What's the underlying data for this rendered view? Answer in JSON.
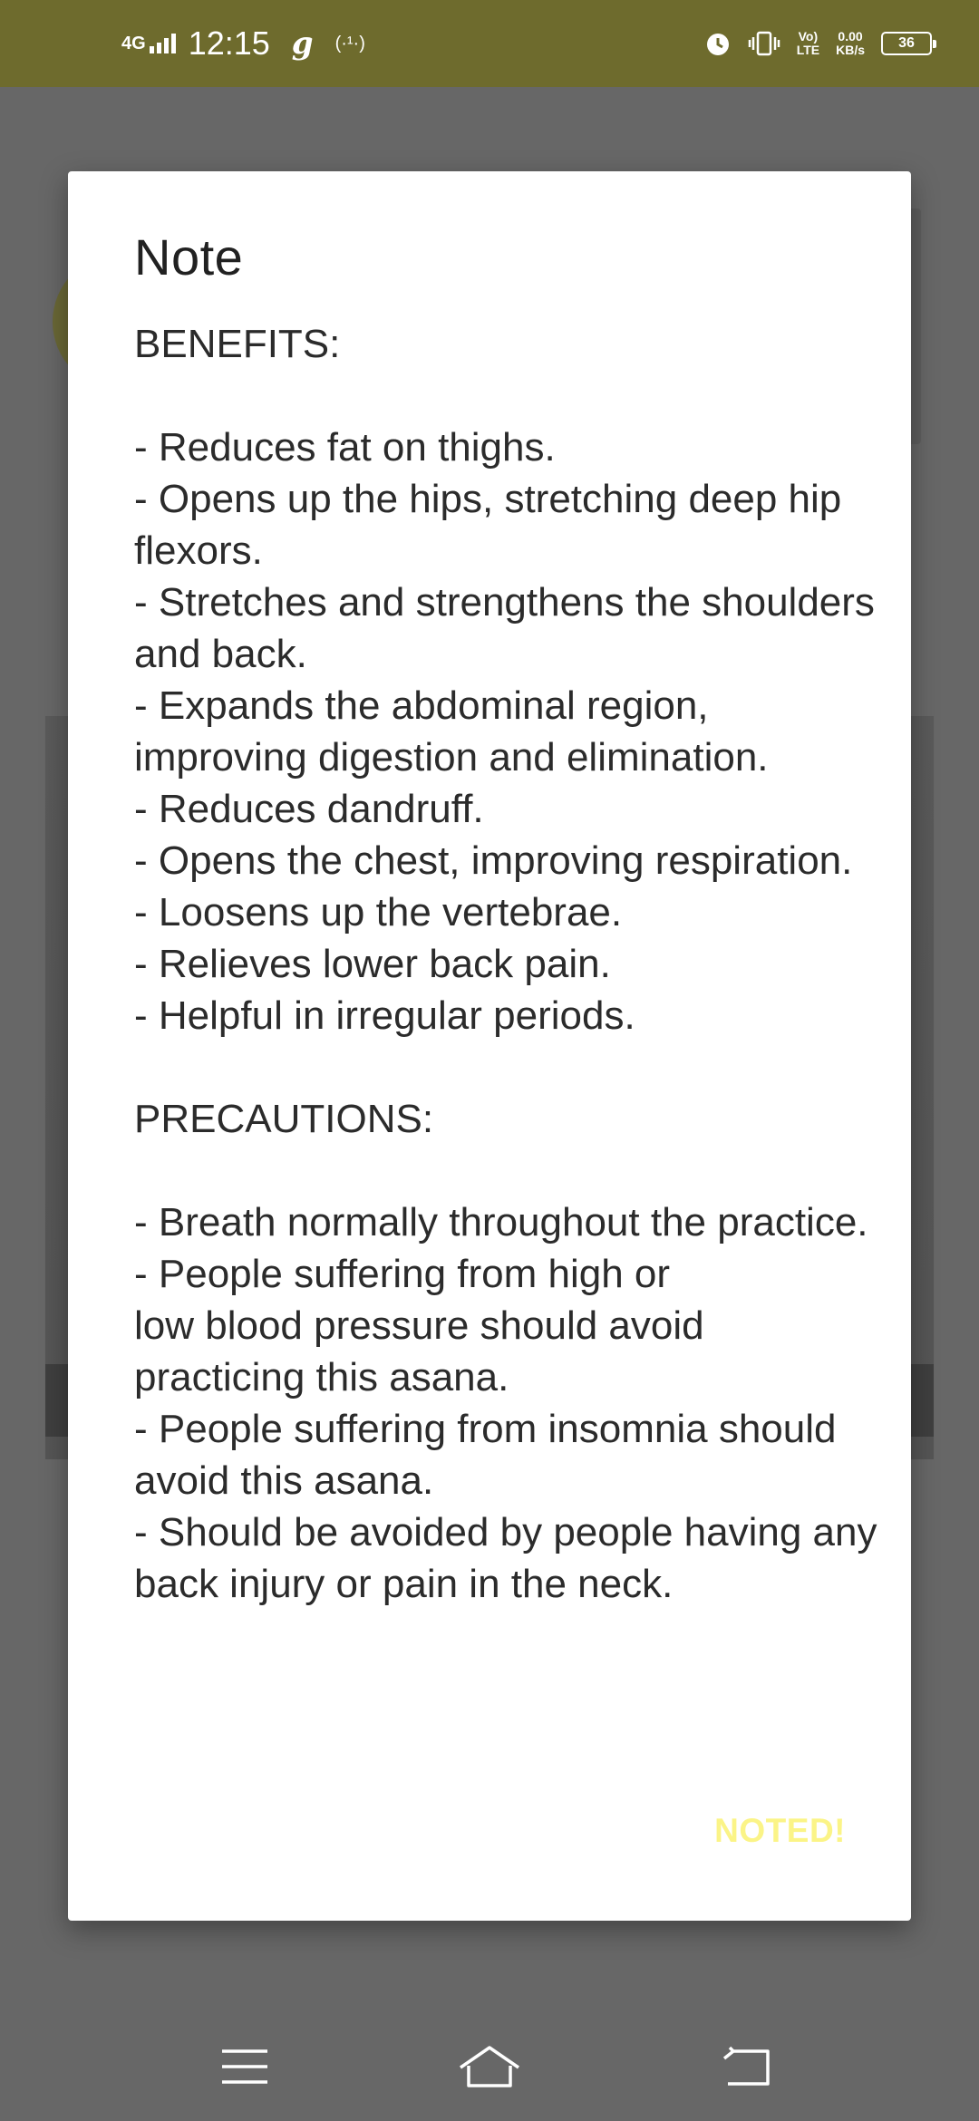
{
  "status_bar": {
    "network": "4G",
    "time": "12:15",
    "app_indicator": "g",
    "hotspot_label": "(·¹·)",
    "volte_top": "Vo)",
    "volte_bottom": "LTE",
    "speed_value": "0.00",
    "speed_unit": "KB/s",
    "battery": "36",
    "icons": [
      "signal-icon",
      "hotspot-icon",
      "alarm-icon",
      "vibrate-icon",
      "battery-icon"
    ],
    "background_color": "#6e6b2d"
  },
  "dialog": {
    "title": "Note",
    "message": "BENEFITS:\n\n- Reduces fat on thighs.\n- Opens up the hips, stretching deep hip flexors.\n- Stretches and strengthens the shoulders and back.\n- Expands the abdominal region, improving digestion and elimination.\n- Reduces dandruff.\n- Opens the chest, improving respiration.\n- Loosens up the vertebrae.\n- Relieves lower back pain.\n- Helpful in irregular periods.\n\nPRECAUTIONS:\n\n- Breath normally throughout the practice.\n- People suffering from high or\nlow blood pressure should avoid practicing this asana.\n- People suffering from insomnia should avoid this asana.\n- Should be avoided by people having any back injury or pain in the neck.",
    "button_label": "NOTED!",
    "button_color": "#fbf487"
  },
  "nav_bar": {
    "icons": [
      "menu-icon",
      "home-icon",
      "back-icon"
    ]
  }
}
